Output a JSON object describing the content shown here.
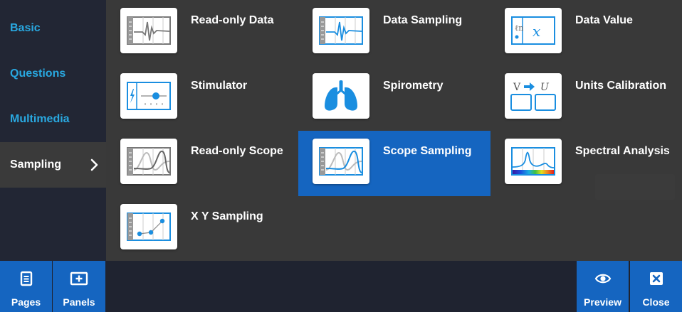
{
  "sidebar": {
    "items": [
      {
        "label": "Basic"
      },
      {
        "label": "Questions"
      },
      {
        "label": "Multimedia"
      },
      {
        "label": "Sampling"
      }
    ]
  },
  "panels": [
    {
      "label": "Read-only Data",
      "icon": "read-only-data-icon"
    },
    {
      "label": "Data Sampling",
      "icon": "data-sampling-icon"
    },
    {
      "label": "Data Value",
      "icon": "data-value-icon"
    },
    {
      "label": "Stimulator",
      "icon": "stimulator-icon"
    },
    {
      "label": "Spirometry",
      "icon": "lungs-icon"
    },
    {
      "label": "Units Calibration",
      "icon": "units-calibration-icon"
    },
    {
      "label": "Read-only Scope",
      "icon": "read-only-scope-icon"
    },
    {
      "label": "Scope Sampling",
      "icon": "scope-sampling-icon"
    },
    {
      "label": "Spectral Analysis",
      "icon": "spectral-analysis-icon"
    },
    {
      "label": "X Y Sampling",
      "icon": "xy-sampling-icon"
    }
  ],
  "bottom": {
    "pages_label": "Pages",
    "panels_label": "Panels",
    "preview_label": "Preview",
    "close_label": "Close"
  },
  "units_icon": {
    "from": "V",
    "to": "U"
  },
  "colors": {
    "accent": "#1565c0",
    "link": "#29a8e0",
    "icon_blue": "#1a8ee0"
  }
}
